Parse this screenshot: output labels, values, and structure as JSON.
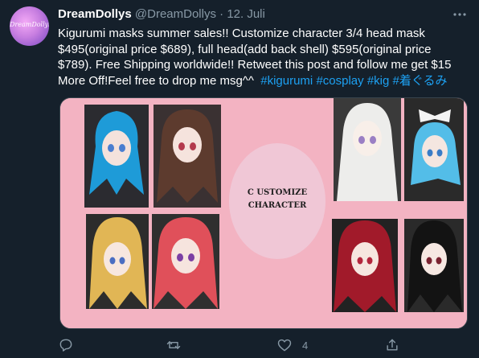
{
  "tweet": {
    "avatar_text": "DreamDollys",
    "display_name": "DreamDollys",
    "handle": "@DreamDollys",
    "separator": "·",
    "date": "12. Juli",
    "text": "Kigurumi masks summer sales!! Customize character 3/4 head mask $495(original price $689), full head(add back shell) $595(original price $789). Free Shipping worldwide!! Retweet this post and follow me get $15 More Off!Feel free to drop me msg^^  ",
    "hashtags": [
      "#kigurumi",
      "#cosplay",
      "#kig",
      "#着ぐるみ"
    ],
    "image": {
      "center_text_line1": "C USTOMIZE",
      "center_text_line2": "CHARACTER"
    },
    "actions": {
      "reply_icon": "reply-icon",
      "retweet_icon": "retweet-icon",
      "like_icon": "like-icon",
      "like_count": "4",
      "share_icon": "share-icon"
    }
  },
  "colors": {
    "background": "#15202b",
    "text": "#ffffff",
    "muted": "#8899a6",
    "hashtag": "#1da1f2",
    "media_background": "#f3b3c2"
  }
}
